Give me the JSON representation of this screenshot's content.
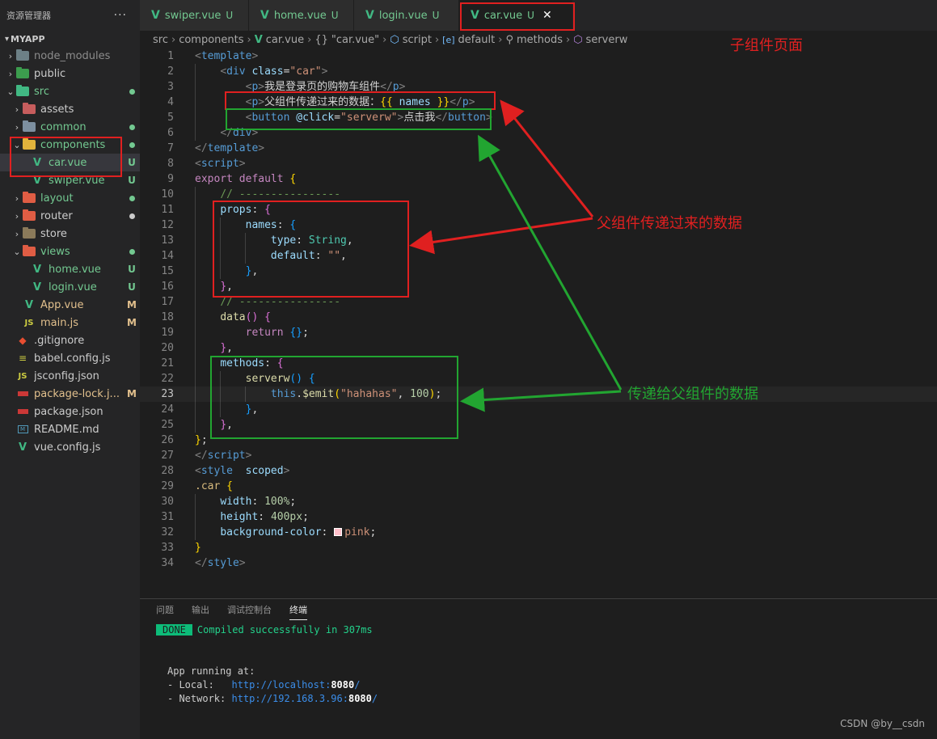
{
  "sidebar": {
    "header_title": "资源管理器",
    "more_label": "···",
    "project": "MYAPP",
    "items": [
      {
        "label": "node_modules",
        "badge": "",
        "color": "#8c8c8c"
      },
      {
        "label": "public",
        "badge": "",
        "color": "#cccccc"
      },
      {
        "label": "src",
        "badge": "●",
        "color": "#73c991"
      },
      {
        "label": "assets",
        "badge": "",
        "color": "#cccccc"
      },
      {
        "label": "common",
        "badge": "●",
        "color": "#73c991"
      },
      {
        "label": "components",
        "badge": "●",
        "color": "#73c991"
      },
      {
        "label": "car.vue",
        "badge": "U",
        "color": "#73c991"
      },
      {
        "label": "swiper.vue",
        "badge": "U",
        "color": "#73c991"
      },
      {
        "label": "layout",
        "badge": "●",
        "color": "#73c991"
      },
      {
        "label": "router",
        "badge": "●",
        "color": "#cccccc"
      },
      {
        "label": "store",
        "badge": "",
        "color": "#cccccc"
      },
      {
        "label": "views",
        "badge": "●",
        "color": "#73c991"
      },
      {
        "label": "home.vue",
        "badge": "U",
        "color": "#73c991"
      },
      {
        "label": "login.vue",
        "badge": "U",
        "color": "#73c991"
      },
      {
        "label": "App.vue",
        "badge": "M",
        "color": "#e2c08d"
      },
      {
        "label": "main.js",
        "badge": "M",
        "color": "#e2c08d"
      },
      {
        "label": ".gitignore",
        "badge": "",
        "color": "#cccccc"
      },
      {
        "label": "babel.config.js",
        "badge": "",
        "color": "#cccccc"
      },
      {
        "label": "jsconfig.json",
        "badge": "",
        "color": "#cccccc"
      },
      {
        "label": "package-lock.j...",
        "badge": "M",
        "color": "#e2c08d"
      },
      {
        "label": "package.json",
        "badge": "",
        "color": "#cccccc"
      },
      {
        "label": "README.md",
        "badge": "",
        "color": "#cccccc"
      },
      {
        "label": "vue.config.js",
        "badge": "",
        "color": "#cccccc"
      }
    ]
  },
  "tabs": [
    {
      "name": "swiper.vue",
      "status": "U"
    },
    {
      "name": "home.vue",
      "status": "U"
    },
    {
      "name": "login.vue",
      "status": "U"
    },
    {
      "name": "car.vue",
      "status": "U",
      "close": "✕"
    }
  ],
  "breadcrumb": {
    "parts": [
      "src",
      "components",
      "car.vue",
      "\"car.vue\"",
      "script",
      "default",
      "methods",
      "serverw"
    ],
    "icons": [
      "",
      "",
      "V",
      "{}",
      "⬡",
      "[e]",
      "🔧",
      "⬡"
    ]
  },
  "code": {
    "line_numbers": [
      "1",
      "2",
      "3",
      "4",
      "5",
      "6",
      "7",
      "8",
      "9",
      "10",
      "11",
      "12",
      "13",
      "14",
      "15",
      "16",
      "17",
      "18",
      "19",
      "20",
      "21",
      "22",
      "23",
      "24",
      "25",
      "26",
      "27",
      "28",
      "29",
      "30",
      "31",
      "32",
      "33",
      "34"
    ],
    "l3_text": "我是登录页的购物车组件",
    "l4_text": "父组件传递过来的数据：",
    "l4_var": "names",
    "l5_attr": "@click",
    "l5_str": "\"serverw\"",
    "l5_text": "点击我",
    "l10_comment": "// ----------------",
    "l17_comment": "// ----------------",
    "l23_args": "\"hahahas\"",
    "l23_num": "100",
    "l30_val": "100%",
    "l31_val": "400px",
    "l32_val": "pink"
  },
  "annotations": {
    "child_page": "子组件页面",
    "from_parent": "父组件传递过来的数据",
    "to_parent": "传递给父组件的数据"
  },
  "panel": {
    "tabs": [
      "问题",
      "输出",
      "调试控制台",
      "终端"
    ],
    "done": "DONE",
    "compiled": "Compiled successfully in 307ms",
    "running": "App running at:",
    "local_label": "- Local:   ",
    "local_url": "http://localhost:",
    "local_port": "8080",
    "network_label": "- Network: ",
    "network_url": "http://192.168.3.96:",
    "network_port": "8080"
  },
  "watermark": "CSDN @by__csdn",
  "colors": {
    "red": "#e02020",
    "green": "#22a531",
    "vue": "#41b883"
  }
}
